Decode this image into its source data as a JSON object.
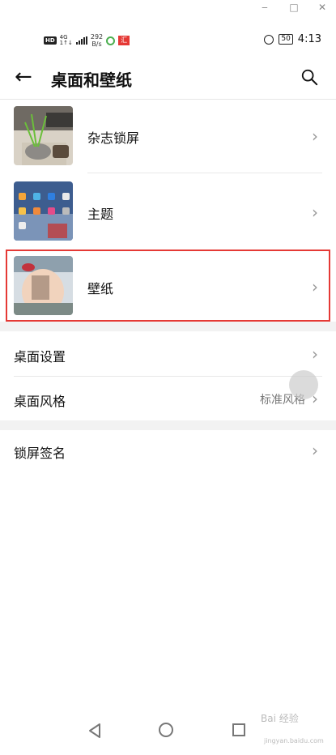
{
  "window": {
    "minimize": "‒",
    "maximize": "□",
    "close": "✕"
  },
  "status": {
    "hd": "HD",
    "net_top": "4G",
    "net_bottom": "1↑↓",
    "speed_top": "292",
    "speed_bottom": "B/s",
    "app_badge": "汇",
    "battery": "50",
    "time": "4:13"
  },
  "header": {
    "title": "桌面和壁纸"
  },
  "items": [
    {
      "label": "杂志锁屏"
    },
    {
      "label": "主题"
    },
    {
      "label": "壁纸"
    }
  ],
  "settings": [
    {
      "label": "桌面设置"
    },
    {
      "label": "桌面风格",
      "value": "标准风格"
    }
  ],
  "lock": {
    "label": "锁屏签名"
  },
  "watermark": {
    "text": "Bai 经验",
    "sub": "jingyan.baidu.com"
  },
  "colors": {
    "highlight": "#e53935"
  }
}
